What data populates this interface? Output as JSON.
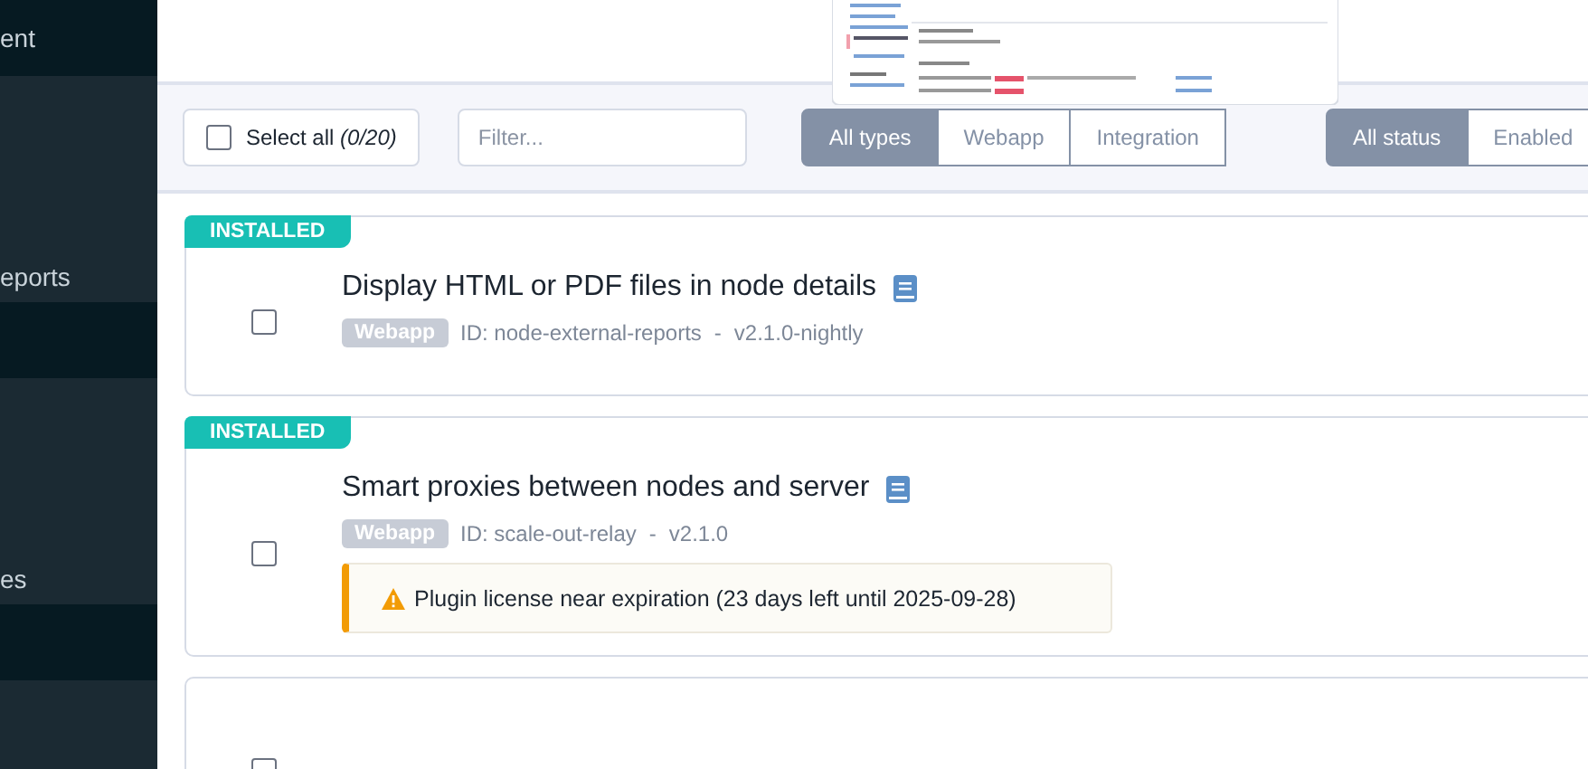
{
  "sidebar": {
    "blocks": [
      {
        "kind": "header",
        "label": "ent"
      },
      {
        "kind": "group",
        "label": "eports"
      },
      {
        "kind": "header"
      },
      {
        "kind": "group",
        "label": "es"
      },
      {
        "kind": "header"
      },
      {
        "kind": "group"
      }
    ]
  },
  "toolbar": {
    "select_all": {
      "label": "Select all",
      "count": "(0/20)",
      "checked": false
    },
    "filter": {
      "placeholder": "Filter..."
    },
    "type_filters": [
      {
        "label": "All types",
        "selected": true
      },
      {
        "label": "Webapp",
        "selected": false
      },
      {
        "label": "Integration",
        "selected": false
      }
    ],
    "status_filters": [
      {
        "label": "All status",
        "selected": true
      },
      {
        "label": "Enabled",
        "selected": false
      }
    ]
  },
  "plugins": [
    {
      "status": "INSTALLED",
      "title": "Display HTML or PDF files in node details",
      "type": "Webapp",
      "id": "ID: node-external-reports",
      "separator": "-",
      "version": "v2.1.0-nightly",
      "checked": false
    },
    {
      "status": "INSTALLED",
      "title": "Smart proxies between nodes and server",
      "type": "Webapp",
      "id": "ID: scale-out-relay",
      "separator": "-",
      "version": "v2.1.0",
      "checked": false,
      "warning": "Plugin license near expiration (23 days left until 2025-09-28)"
    },
    {
      "checked": false
    }
  ]
}
